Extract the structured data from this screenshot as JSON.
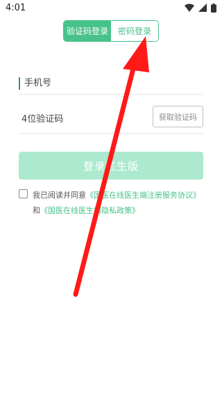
{
  "statusbar": {
    "time": "4:01"
  },
  "mode_toggle": {
    "sms_label": "验证码登录",
    "password_label": "密码登录"
  },
  "form": {
    "phone_placeholder": "手机号",
    "code_placeholder": "4位验证码",
    "get_code_label": "获取验证码",
    "login_label": "登录医生版"
  },
  "agreement": {
    "prefix": "我已阅读并同意",
    "registration_link": "《国医在线医生端注册服务协议》",
    "conjunction": "和",
    "privacy_link": "《国医在线医生端隐私政策》"
  },
  "colors": {
    "accent": "#47c28a",
    "login_disabled": "#ace9ce",
    "arrow": "#ff1a1a"
  },
  "icons": [
    "wifi-icon",
    "signal-icon",
    "battery-icon",
    "red-arrow-annotation"
  ]
}
